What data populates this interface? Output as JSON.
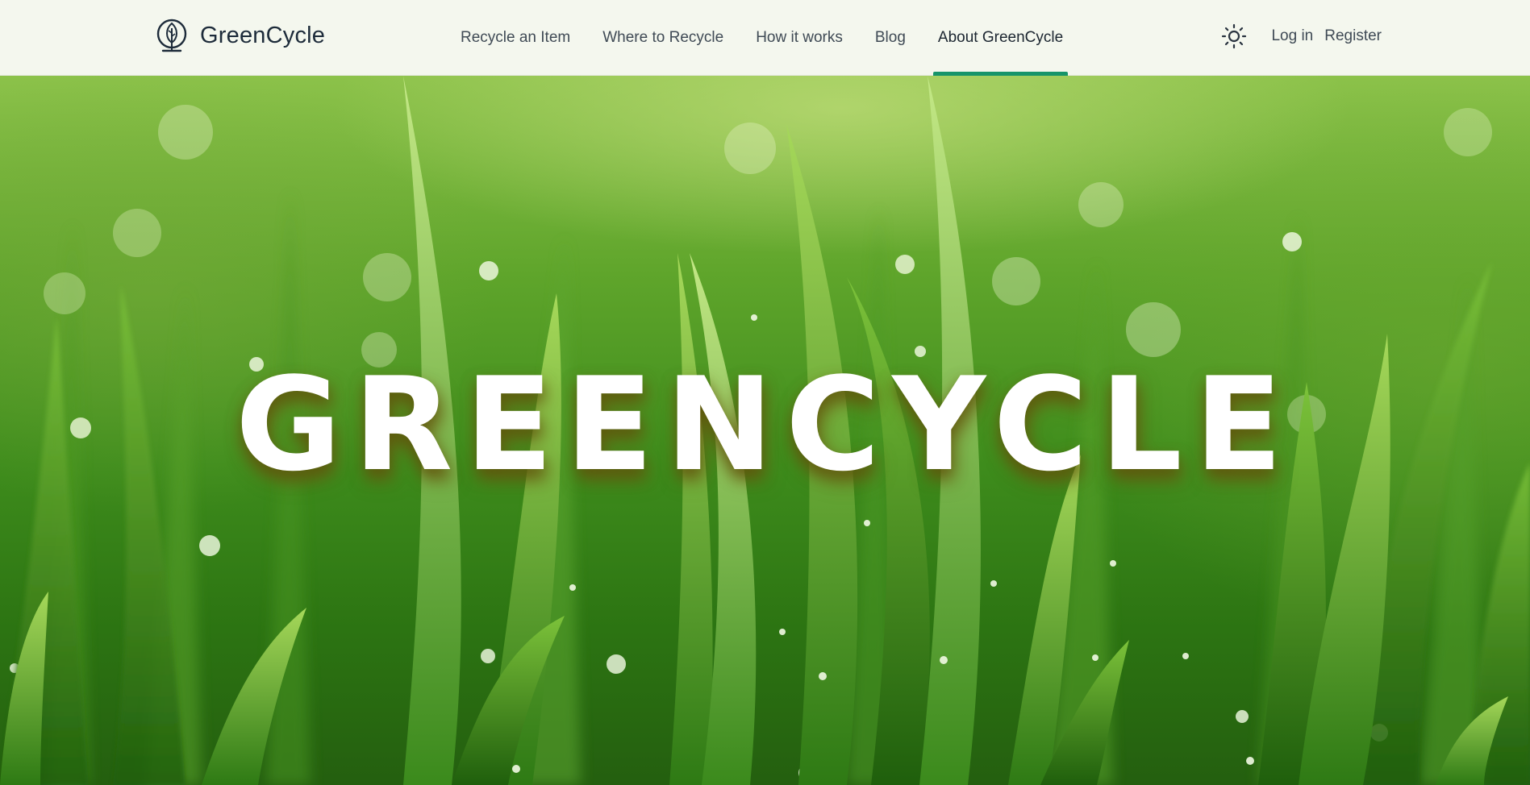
{
  "brand": {
    "name": "GreenCycle",
    "logo_icon": "sprout-leaf-icon"
  },
  "nav": {
    "items": [
      {
        "label": "Recycle an Item",
        "active": false
      },
      {
        "label": "Where to Recycle",
        "active": false
      },
      {
        "label": "How it works",
        "active": false
      },
      {
        "label": "Blog",
        "active": false
      },
      {
        "label": "About GreenCycle",
        "active": true
      }
    ]
  },
  "right_nav": {
    "theme_icon": "sun-icon",
    "login_label": "Log in",
    "register_label": "Register"
  },
  "hero": {
    "title": "GREENCYCLE",
    "background": "dewy green grass close-up"
  },
  "colors": {
    "header_bg": "#f4f7ee",
    "active_underline": "#16946a",
    "text_dark": "#1d2b3a",
    "nav_text": "#3f4a55",
    "hero_title": "#ffffff"
  }
}
